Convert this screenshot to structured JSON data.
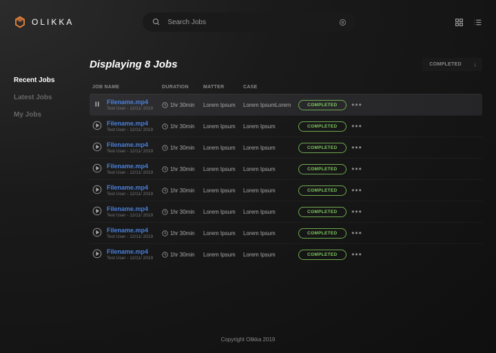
{
  "brand": "OLIKKA",
  "search": {
    "placeholder": "Search Jobs"
  },
  "sidebar": {
    "items": [
      {
        "label": "Recent Jobs",
        "active": true
      },
      {
        "label": "Latest Jobs",
        "active": false
      },
      {
        "label": "My Jobs",
        "active": false
      }
    ]
  },
  "heading": "Displaying 8 Jobs",
  "filter": {
    "selected": "COMPLETED"
  },
  "columns": {
    "name": "JOB NAME",
    "duration": "DURATION",
    "matter": "MATTER",
    "case": "CASE"
  },
  "jobs": [
    {
      "name": "Filename.mp4",
      "sub": "Test User - 12/11/ 2019",
      "duration": "1hr 30min",
      "matter": "Lorem Ipsum",
      "case": "Lorem IpsumLorem",
      "status": "COMPLETED",
      "playing": true
    },
    {
      "name": "Filename.mp4",
      "sub": "Test User - 12/11/ 2019",
      "duration": "1hr 30min",
      "matter": "Lorem Ipsum",
      "case": "Lorem Ipsum",
      "status": "COMPLETED",
      "playing": false
    },
    {
      "name": "Filename.mp4",
      "sub": "Test User - 12/11/ 2019",
      "duration": "1hr 30min",
      "matter": "Lorem Ipsum",
      "case": "Lorem Ipsum",
      "status": "COMPLETED",
      "playing": false
    },
    {
      "name": "Filename.mp4",
      "sub": "Test User - 12/11/ 2019",
      "duration": "1hr 30min",
      "matter": "Lorem Ipsum",
      "case": "Lorem Ipsum",
      "status": "COMPLETED",
      "playing": false
    },
    {
      "name": "Filename.mp4",
      "sub": "Test User - 12/11/ 2019",
      "duration": "1hr 30min",
      "matter": "Lorem Ipsum",
      "case": "Lorem Ipsum",
      "status": "COMPLETED",
      "playing": false
    },
    {
      "name": "Filename.mp4",
      "sub": "Test User - 12/11/ 2019",
      "duration": "1hr 30min",
      "matter": "Lorem Ipsum",
      "case": "Lorem Ipsum",
      "status": "COMPLETED",
      "playing": false
    },
    {
      "name": "Filename.mp4",
      "sub": "Test User - 12/11/ 2019",
      "duration": "1hr 30min",
      "matter": "Lorem Ipsum",
      "case": "Lorem Ipsum",
      "status": "COMPLETED",
      "playing": false
    },
    {
      "name": "Filename.mp4",
      "sub": "Test User - 12/11/ 2019",
      "duration": "1hr 30min",
      "matter": "Lorem Ipsum",
      "case": "Lorem Ipsum",
      "status": "COMPLETED",
      "playing": false
    }
  ],
  "footer": "Copyright Olikka 2019"
}
